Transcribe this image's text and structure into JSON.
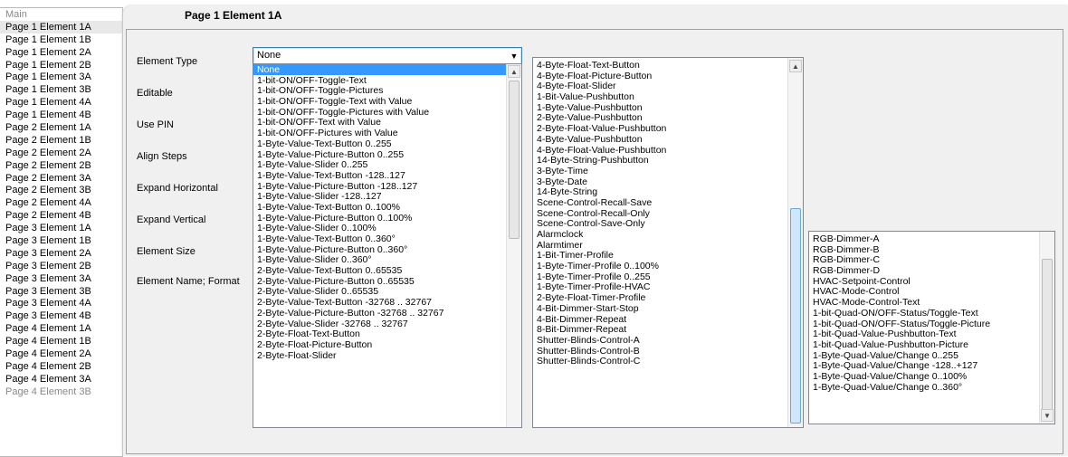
{
  "tree": {
    "items": [
      "Main",
      "Page 1 Element 1A",
      "Page 1 Element 1B",
      "Page 1 Element 2A",
      "Page 1 Element 2B",
      "Page 1 Element 3A",
      "Page 1 Element 3B",
      "Page 1 Element 4A",
      "Page 1 Element 4B",
      "Page 2 Element 1A",
      "Page 2 Element 1B",
      "Page 2 Element 2A",
      "Page 2 Element 2B",
      "Page 2 Element 3A",
      "Page 2 Element 3B",
      "Page 2 Element 4A",
      "Page 2 Element 4B",
      "Page 3 Element 1A",
      "Page 3 Element 1B",
      "Page 3 Element 2A",
      "Page 3 Element 2B",
      "Page 3 Element 3A",
      "Page 3 Element 3B",
      "Page 3 Element 4A",
      "Page 3 Element 4B",
      "Page 4 Element 1A",
      "Page 4 Element 1B",
      "Page 4 Element 2A",
      "Page 4 Element 2B",
      "Page 4 Element 3A",
      "Page 4 Element 3B"
    ]
  },
  "panel": {
    "title": "Page 1 Element 1A",
    "labels": {
      "element_type": "Element Type",
      "editable": "Editable",
      "use_pin": "Use PIN",
      "align_steps": "Align Steps",
      "expand_horizontal": "Expand Horizontal",
      "expand_vertical": "Expand Vertical",
      "element_size": "Element Size",
      "element_name_format": "Element Name; Format"
    },
    "element_type_value": "None"
  },
  "list1": [
    "None",
    "1-bit-ON/OFF-Toggle-Text",
    "1-bit-ON/OFF-Toggle-Pictures",
    "1-bit-ON/OFF-Toggle-Text with Value",
    "1-bit-ON/OFF-Toggle-Pictures with Value",
    "1-bit-ON/OFF-Text with Value",
    "1-bit-ON/OFF-Pictures with Value",
    "1-Byte-Value-Text-Button 0..255",
    "1-Byte-Value-Picture-Button 0..255",
    "1-Byte-Value-Slider 0..255",
    "1-Byte-Value-Text-Button -128..127",
    "1-Byte-Value-Picture-Button -128..127",
    "1-Byte-Value-Slider -128..127",
    "1-Byte-Value-Text-Button 0..100%",
    "1-Byte-Value-Picture-Button 0..100%",
    "1-Byte-Value-Slider 0..100%",
    "1-Byte-Value-Text-Button 0..360°",
    "1-Byte-Value-Picture-Button 0..360°",
    "1-Byte-Value-Slider 0..360°",
    "2-Byte-Value-Text-Button 0..65535",
    "2-Byte-Value-Picture-Button 0..65535",
    "2-Byte-Value-Slider 0..65535",
    "2-Byte-Value-Text-Button -32768 .. 32767",
    "2-Byte-Value-Picture-Button -32768 .. 32767",
    "2-Byte-Value-Slider -32768 .. 32767",
    "2-Byte-Float-Text-Button",
    "2-Byte-Float-Picture-Button",
    "2-Byte-Float-Slider"
  ],
  "list2": [
    "4-Byte-Float-Text-Button",
    "4-Byte-Float-Picture-Button",
    "4-Byte-Float-Slider",
    "1-Bit-Value-Pushbutton",
    "1-Byte-Value-Pushbutton",
    "2-Byte-Value-Pushbutton",
    "2-Byte-Float-Value-Pushbutton",
    "4-Byte-Value-Pushbutton",
    "4-Byte-Float-Value-Pushbutton",
    "14-Byte-String-Pushbutton",
    "3-Byte-Time",
    "3-Byte-Date",
    "14-Byte-String",
    "Scene-Control-Recall-Save",
    "Scene-Control-Recall-Only",
    "Scene-Control-Save-Only",
    "Alarmclock",
    "Alarmtimer",
    "1-Bit-Timer-Profile",
    "1-Byte-Timer-Profile 0..100%",
    "1-Byte-Timer-Profile 0..255",
    "1-Byte-Timer-Profile-HVAC",
    "2-Byte-Float-Timer-Profile",
    "4-Bit-Dimmer-Start-Stop",
    "4-Bit-Dimmer-Repeat",
    "8-Bit-Dimmer-Repeat",
    "Shutter-Blinds-Control-A",
    "Shutter-Blinds-Control-B",
    "Shutter-Blinds-Control-C"
  ],
  "list3": [
    "RGB-Dimmer-A",
    "RGB-Dimmer-B",
    "RGB-Dimmer-C",
    "RGB-Dimmer-D",
    "HVAC-Setpoint-Control",
    "HVAC-Mode-Control",
    "HVAC-Mode-Control-Text",
    "1-bit-Quad-ON/OFF-Status/Toggle-Text",
    "1-bit-Quad-ON/OFF-Status/Toggle-Picture",
    "1-bit-Quad-Value-Pushbutton-Text",
    "1-bit-Quad-Value-Pushbutton-Picture",
    "1-Byte-Quad-Value/Change 0..255",
    "1-Byte-Quad-Value/Change -128..+127",
    "1-Byte-Quad-Value/Change 0..100%",
    "1-Byte-Quad-Value/Change 0..360°"
  ],
  "icons": {
    "dropdown": "chevron-down-icon",
    "scroll_up": "arrow-up-icon",
    "scroll_down": "arrow-down-icon"
  },
  "colors": {
    "selection": "#3399ff",
    "select_border": "#3c7fb1"
  }
}
